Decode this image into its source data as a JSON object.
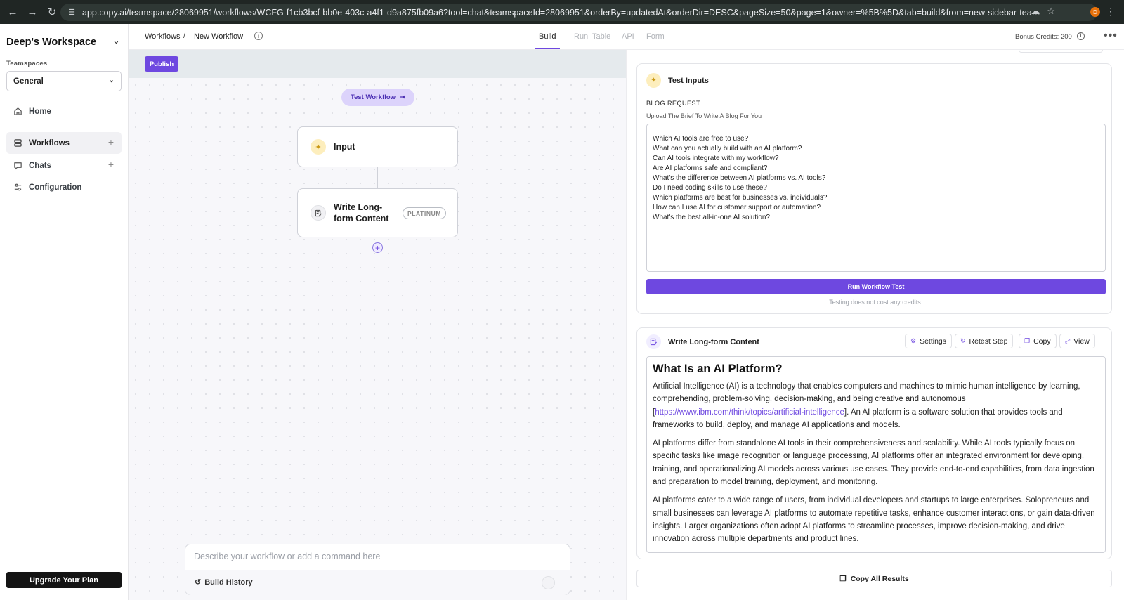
{
  "browser": {
    "url": "app.copy.ai/teamspace/28069951/workflows/WCFG-f1cb3bcf-bb0e-403c-a4f1-d9a875fb09a6?tool=chat&teamspaceId=28069951&orderBy=updatedAt&orderDir=DESC&pageSize=50&page=1&owner=%5B%5D&tab=build&from=new-sidebar-teamspace&node=&nextInternalLocale=en&w...",
    "profile_initial": "D"
  },
  "sidebar": {
    "workspace_name": "Deep's Workspace",
    "teamspaces_label": "Teamspaces",
    "teamspace_selected": "General",
    "items": [
      {
        "label": "Home",
        "icon": "home-icon"
      },
      {
        "label": "Workflows",
        "icon": "workflows-icon"
      },
      {
        "label": "Chats",
        "icon": "chat-icon"
      },
      {
        "label": "Configuration",
        "icon": "sliders-icon"
      }
    ],
    "upgrade_label": "Upgrade Your Plan"
  },
  "header": {
    "breadcrumb_root": "Workflows",
    "breadcrumb_sep": "/",
    "breadcrumb_current": "New Workflow",
    "tabs": [
      "Build",
      "Run",
      "Table",
      "API",
      "Form"
    ],
    "active_tab": "Build",
    "bonus_credits": "Bonus Credits: 200"
  },
  "canvas": {
    "publish_label": "Publish",
    "test_workflow_label": "Test Workflow",
    "nodes": [
      {
        "label": "Input"
      },
      {
        "label": "Write Long-form Content",
        "badge": "PLATINUM"
      }
    ],
    "command_placeholder": "Describe your workflow or add a command here",
    "build_history_label": "Build History"
  },
  "test_inputs": {
    "title": "Test Inputs",
    "field_label": "BLOG REQUEST",
    "field_sub": "Upload The Brief To Write A Blog For You",
    "questions": [
      "Which AI tools are free to use?",
      "What can you actually build with an AI platform?",
      "Can AI tools integrate with my workflow?",
      "Are AI platforms safe and compliant?",
      "What's the difference between AI platforms vs. AI tools?",
      "Do I need coding skills to use these?",
      "Which platforms are best for businesses vs. individuals?",
      "How can I use AI for customer support or automation?",
      "What's the best all-in-one AI solution?"
    ],
    "run_label": "Run Workflow Test",
    "no_cost_note": "Testing does not cost any credits"
  },
  "result": {
    "title": "Write Long-form Content",
    "actions": [
      "Settings",
      "Retest Step",
      "Copy",
      "View"
    ],
    "heading": "What Is an AI Platform?",
    "p1_a": "Artificial Intelligence (AI) is a technology that enables computers and machines to mimic human intelligence by learning, comprehending, problem-solving, decision-making, and being creative and autonomous [",
    "p1_link": "https://www.ibm.com/think/topics/artificial-intelligence",
    "p1_b": "]. An AI platform is a software solution that provides tools and frameworks to build, deploy, and manage AI applications and models.",
    "p2": "AI platforms differ from standalone AI tools in their comprehensiveness and scalability. While AI tools typically focus on specific tasks like image recognition or language processing, AI platforms offer an integrated environment for developing, training, and operationalizing AI models across various use cases. They provide end-to-end capabilities, from data ingestion and preparation to model training, deployment, and monitoring.",
    "p3": "AI platforms cater to a wide range of users, from individual developers and startups to large enterprises. Solopreneurs and small businesses can leverage AI platforms to automate repetitive tasks, enhance customer interactions, or gain data-driven insights. Larger organizations often adopt AI platforms to streamline processes, improve decision-making, and drive innovation across multiple departments and product lines.",
    "copy_all_label": "Copy All Results"
  },
  "colors": {
    "accent": "#6e48e0",
    "test_btn_bg": "#dcd3fb",
    "input_icon_bg": "#fdeebd"
  }
}
